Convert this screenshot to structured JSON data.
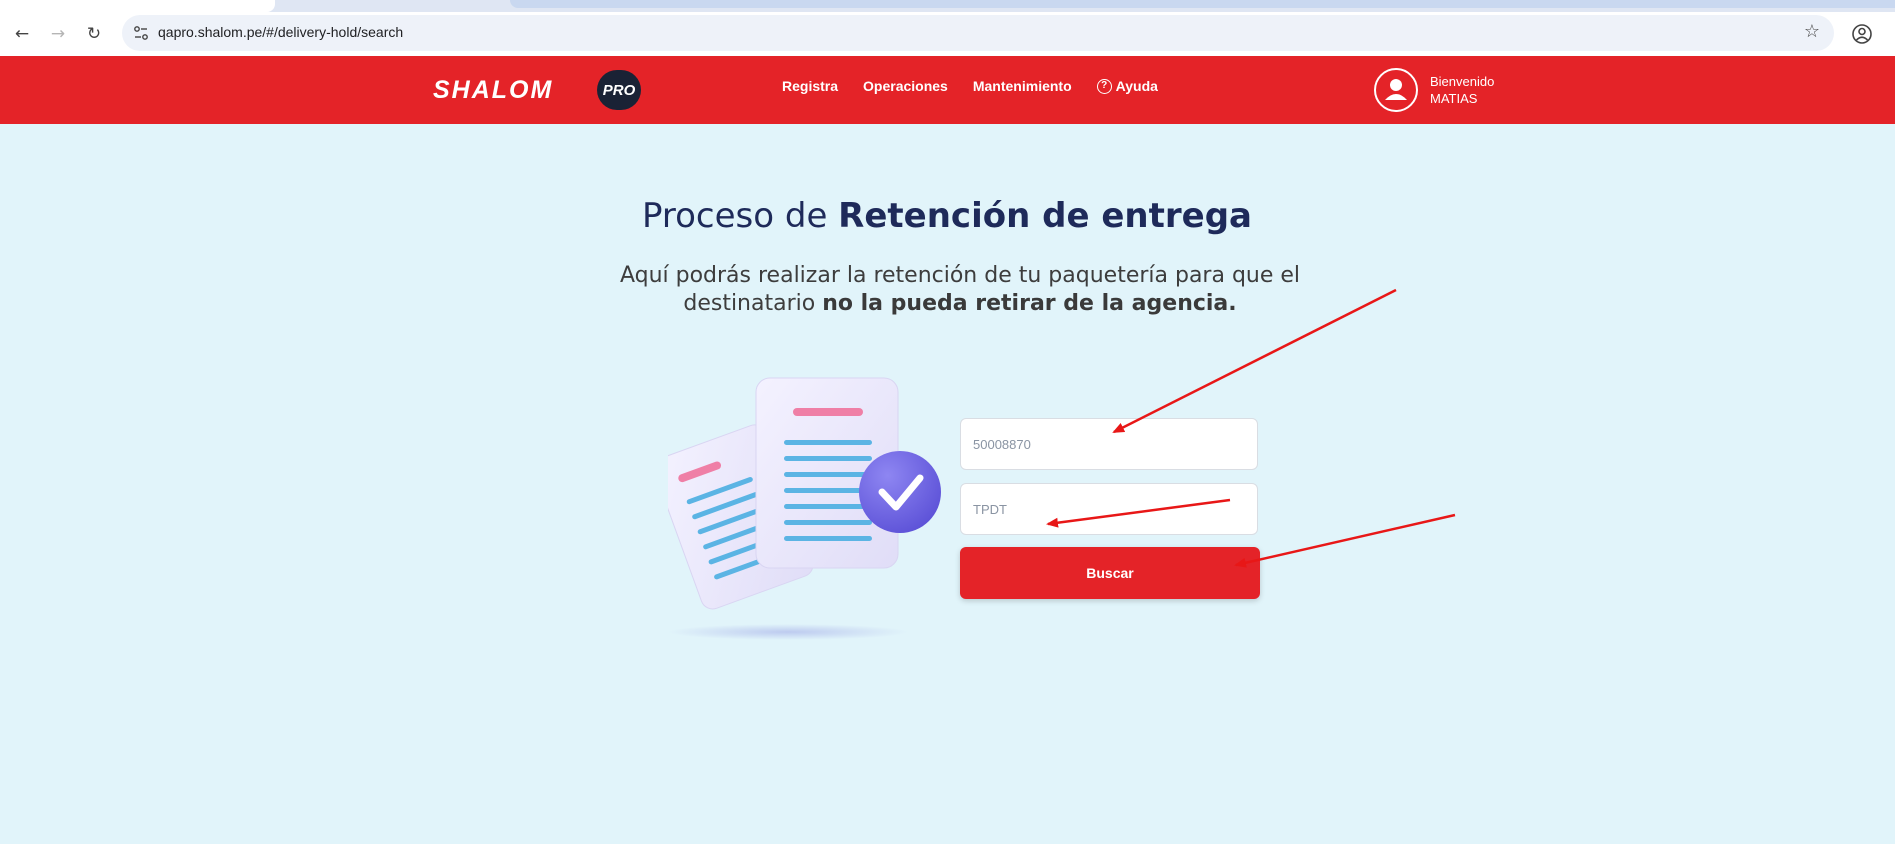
{
  "browser": {
    "url": "qapro.shalom.pe/#/delivery-hold/search",
    "back_icon": "←",
    "forward_icon": "→",
    "reload_icon": "↻",
    "star_icon": "☆"
  },
  "header": {
    "logo_text": "SHALOM",
    "logo_badge": "PRO",
    "nav": [
      {
        "label": "Registra"
      },
      {
        "label": "Operaciones"
      },
      {
        "label": "Mantenimiento"
      },
      {
        "label": "Ayuda",
        "icon": "?"
      }
    ],
    "user": {
      "greeting": "Bienvenido",
      "name": "MATIAS"
    },
    "brand_color": "#e42328"
  },
  "main": {
    "title_regular": "Proceso de ",
    "title_bold": "Retención de entrega",
    "subtitle_regular_1": "Aquí podrás realizar la retención de tu paquetería para que el destinatario ",
    "subtitle_bold": "no la pueda retirar de la agencia.",
    "form": {
      "tracking_value": "",
      "tracking_placeholder": "50008870",
      "code_value": "",
      "code_placeholder": "TPDT",
      "submit_label": "Buscar"
    }
  },
  "colors": {
    "page_bg": "#e1f4fa",
    "title": "#1e2a5a",
    "annotation_arrow": "#e81717"
  }
}
